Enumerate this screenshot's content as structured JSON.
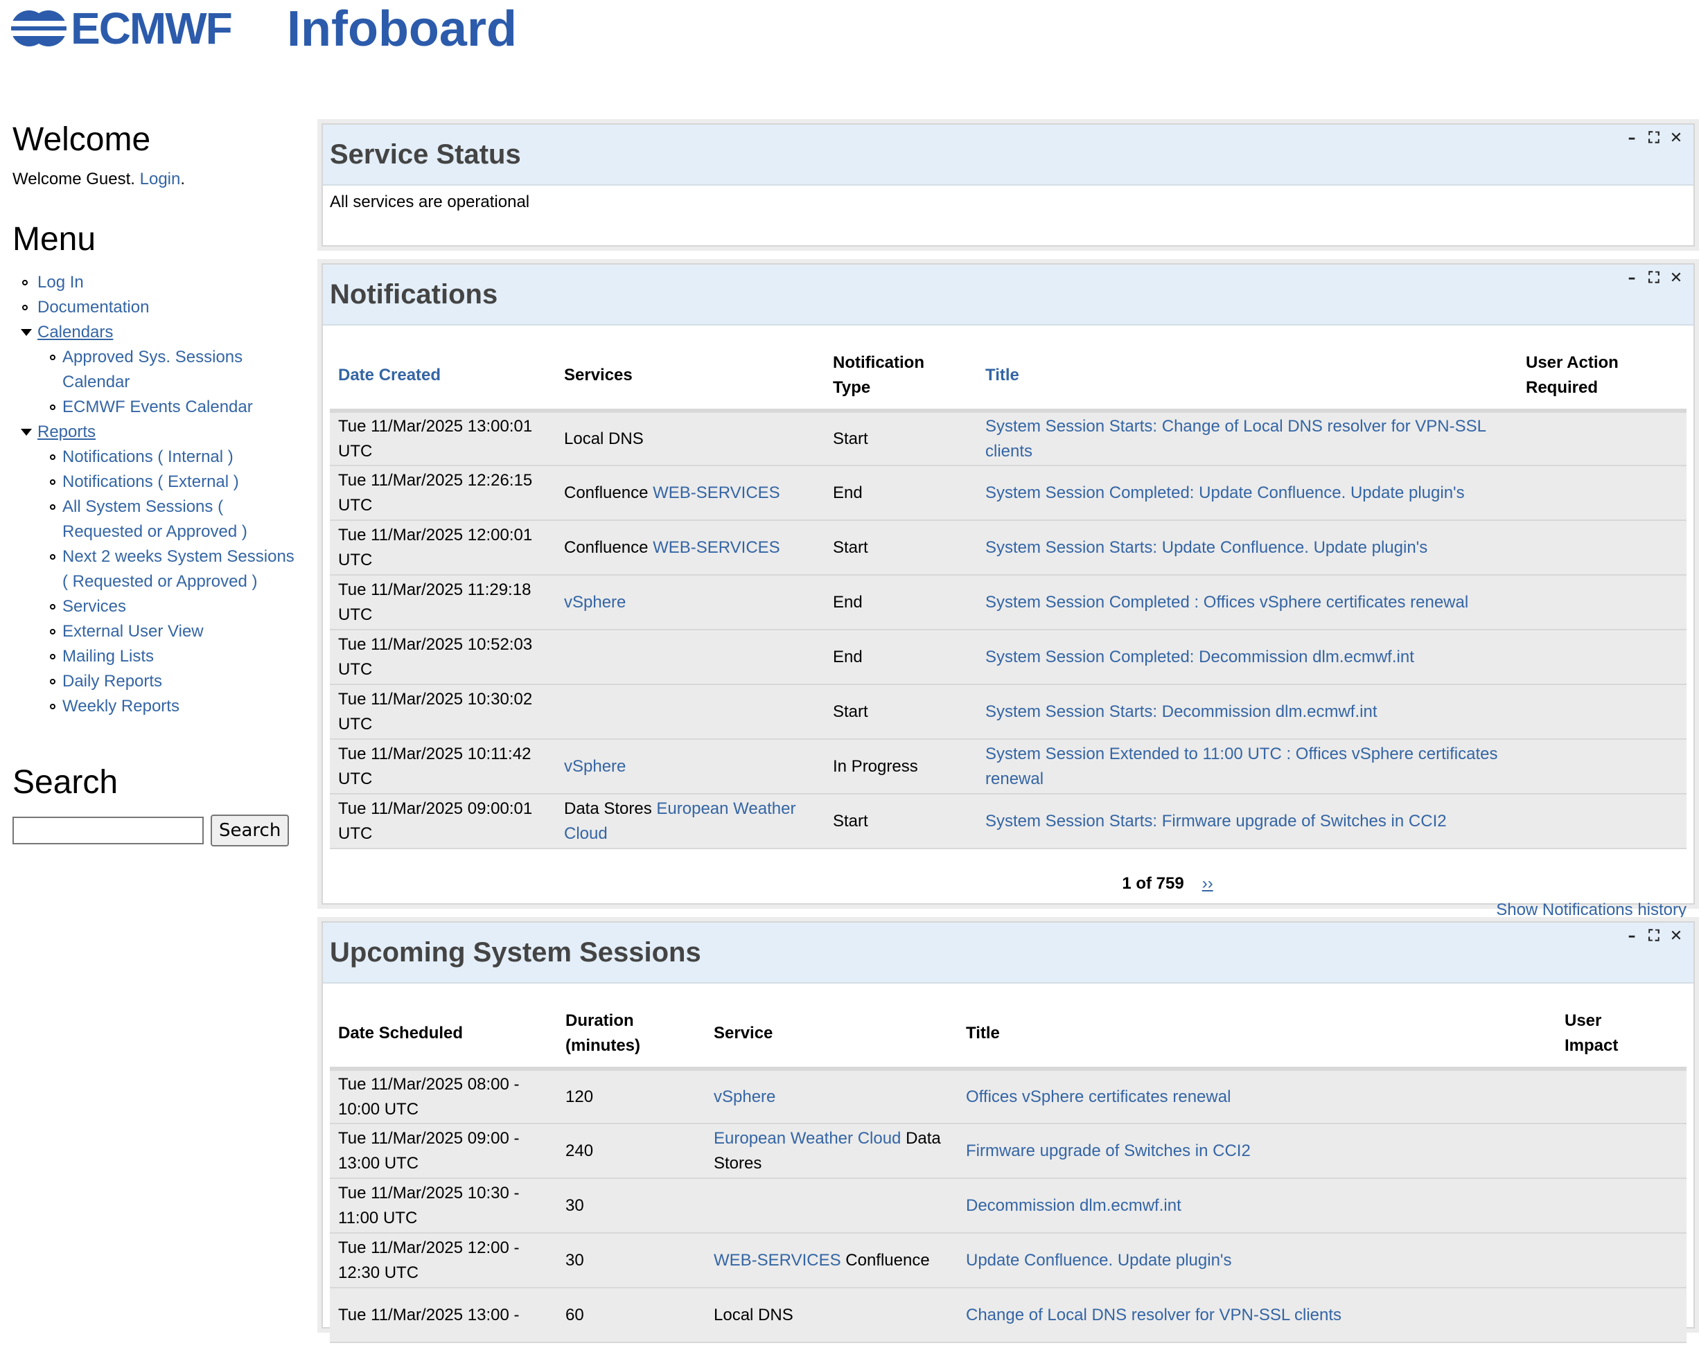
{
  "header": {
    "logo_text": "ECMWF",
    "app_title": "Infoboard"
  },
  "sidebar": {
    "welcome_heading": "Welcome",
    "welcome_text": "Welcome Guest. ",
    "login_link": "Login",
    "welcome_end": ".",
    "menu_heading": "Menu",
    "menu": {
      "log_in": "Log In",
      "documentation": "Documentation",
      "calendars": "Calendars",
      "approved_sessions": "Approved Sys. Sessions Calendar",
      "events_calendar": "ECMWF Events Calendar",
      "reports": "Reports",
      "notif_internal": "Notifications ( Internal )",
      "notif_external": "Notifications ( External )",
      "all_sessions": "All System Sessions ( Requested or Approved )",
      "next_2_weeks": "Next 2 weeks System Sessions ( Requested or Approved )",
      "services": "Services",
      "external_user_view": "External User View",
      "mailing_lists": "Mailing Lists",
      "daily_reports": "Daily Reports",
      "weekly_reports": "Weekly Reports"
    },
    "search_heading": "Search",
    "search_value": "",
    "search_button": "Search"
  },
  "controls": {
    "minimize": "–",
    "maximize": "⛶",
    "close": "✕"
  },
  "service_status": {
    "title": "Service Status",
    "message": "All services are operational"
  },
  "notifications": {
    "title": "Notifications",
    "headers": {
      "date": "Date Created",
      "services": "Services",
      "type_line1": "Notification",
      "type_line2": "Type",
      "title": "Title",
      "action_line1": "User Action",
      "action_line2": "Required"
    },
    "rows": [
      {
        "date1": "Tue 11/Mar/2025 13:00:01",
        "date2": "UTC",
        "svc_text": "Local DNS",
        "svc_link": "",
        "type": "Start",
        "title": "System Session Starts: Change of Local DNS resolver for VPN-SSL clients",
        "action": ""
      },
      {
        "date1": "Tue 11/Mar/2025 12:26:15",
        "date2": "UTC",
        "svc_text": "Confluence ",
        "svc_link": "WEB-SERVICES",
        "type": "End",
        "title": "System Session Completed: Update Confluence. Update plugin's",
        "action": ""
      },
      {
        "date1": "Tue 11/Mar/2025 12:00:01",
        "date2": "UTC",
        "svc_text": "Confluence ",
        "svc_link": "WEB-SERVICES",
        "type": "Start",
        "title": "System Session Starts: Update Confluence. Update plugin's",
        "action": ""
      },
      {
        "date1": "Tue 11/Mar/2025 11:29:18",
        "date2": "UTC",
        "svc_text": "",
        "svc_link": "vSphere",
        "type": "End",
        "title": "System Session Completed : Offices vSphere certificates renewal",
        "action": ""
      },
      {
        "date1": "Tue 11/Mar/2025 10:52:03",
        "date2": "UTC",
        "svc_text": "",
        "svc_link": "",
        "type": "End",
        "title": "System Session Completed: Decommission dlm.ecmwf.int",
        "action": ""
      },
      {
        "date1": "Tue 11/Mar/2025 10:30:02",
        "date2": "UTC",
        "svc_text": "",
        "svc_link": "",
        "type": "Start",
        "title": "System Session Starts: Decommission dlm.ecmwf.int",
        "action": ""
      },
      {
        "date1": "Tue 11/Mar/2025 10:11:42",
        "date2": "UTC",
        "svc_text": "",
        "svc_link": "vSphere",
        "type": "In Progress",
        "title": "System Session Extended to 11:00 UTC : Offices vSphere certificates renewal",
        "action": ""
      },
      {
        "date1": "Tue 11/Mar/2025 09:00:01",
        "date2": "UTC",
        "svc_text": "Data Stores ",
        "svc_link": "European Weather Cloud",
        "type": "Start",
        "title": "System Session Starts: Firmware upgrade of Switches in CCI2",
        "action": ""
      }
    ],
    "pager_text": "1 of 759",
    "pager_next": "››",
    "history_link": "Show Notifications history"
  },
  "upcoming": {
    "title": "Upcoming System Sessions",
    "headers": {
      "date": "Date Scheduled",
      "duration_line1": "Duration",
      "duration_line2": "(minutes)",
      "service": "Service",
      "title": "Title",
      "impact_line1": "User",
      "impact_line2": "Impact"
    },
    "rows": [
      {
        "date1": "Tue 11/Mar/2025 08:00 -",
        "date2": "10:00 UTC",
        "duration": "120",
        "svc_link": "vSphere",
        "svc_text": "",
        "title": "Offices vSphere certificates renewal",
        "impact": ""
      },
      {
        "date1": "Tue 11/Mar/2025 09:00 -",
        "date2": "13:00 UTC",
        "duration": "240",
        "svc_link": "European Weather Cloud",
        "svc_text": " Data Stores",
        "title": "Firmware upgrade of Switches in CCI2",
        "impact": ""
      },
      {
        "date1": "Tue 11/Mar/2025 10:30 -",
        "date2": "11:00 UTC",
        "duration": "30",
        "svc_link": "",
        "svc_text": "",
        "title": "Decommission dlm.ecmwf.int",
        "impact": ""
      },
      {
        "date1": "Tue 11/Mar/2025 12:00 -",
        "date2": "12:30 UTC",
        "duration": "30",
        "svc_link": "WEB-SERVICES",
        "svc_text": " Confluence",
        "title": "Update Confluence. Update plugin's",
        "impact": ""
      },
      {
        "date1": "Tue 11/Mar/2025 13:00 -",
        "date2": "",
        "duration": "60",
        "svc_link": "",
        "svc_text": "Local DNS",
        "title": "Change of Local DNS resolver for VPN-SSL clients",
        "impact": ""
      }
    ]
  }
}
